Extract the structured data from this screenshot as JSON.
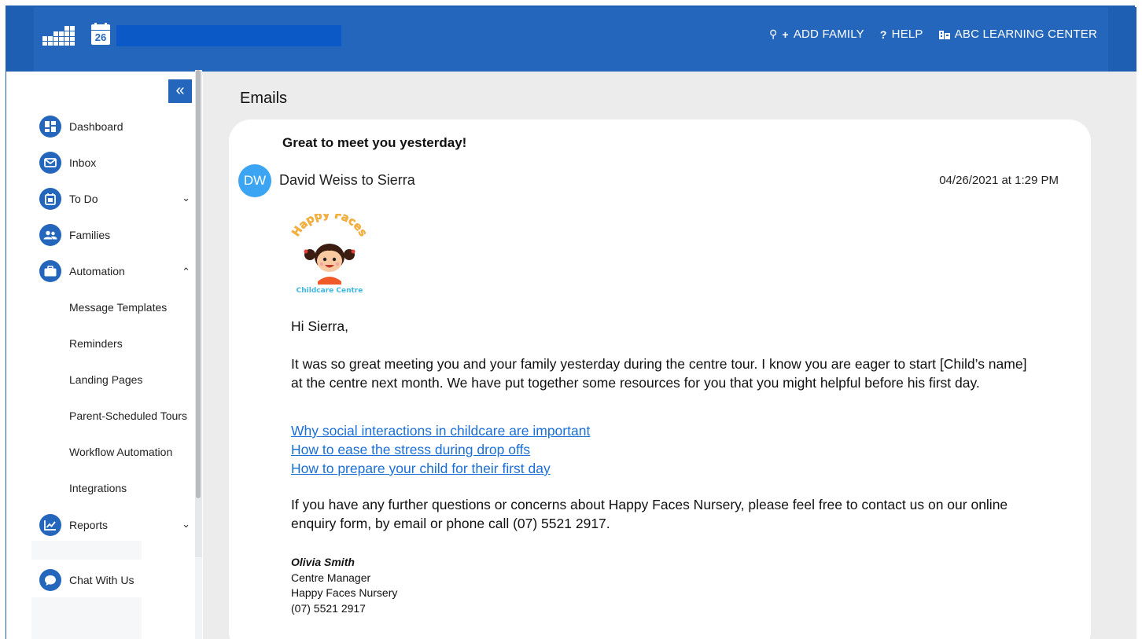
{
  "header": {
    "calendar_day": "26",
    "add_family_label": "ADD FAMILY",
    "help_label": "HELP",
    "center_label": "ABC LEARNING CENTER",
    "colors": {
      "header_bg": "#2466bb",
      "accent": "#2466bb"
    }
  },
  "sidebar": {
    "collapse_icon": "«",
    "items": [
      {
        "label": "Dashboard",
        "icon": "dashboard-icon"
      },
      {
        "label": "Inbox",
        "icon": "envelope-icon"
      },
      {
        "label": "To Do",
        "icon": "calendar-icon",
        "expanded": false
      },
      {
        "label": "Families",
        "icon": "people-icon"
      },
      {
        "label": "Automation",
        "icon": "briefcase-icon",
        "expanded": true
      },
      {
        "label": "Reports",
        "icon": "chart-icon",
        "expanded": false
      },
      {
        "label": "Chat With Us",
        "icon": "chat-icon"
      }
    ],
    "automation_children": [
      "Message Templates",
      "Reminders",
      "Landing Pages",
      "Parent-Scheduled Tours",
      "Workflow Automation",
      "Integrations"
    ]
  },
  "main": {
    "page_title": "Emails",
    "email": {
      "subject": "Great to meet you yesterday!",
      "avatar_initials": "DW",
      "from_to": "David Weiss to Sierra",
      "timestamp": "04/26/2021 at 1:29 PM",
      "brand": {
        "arc_text": "Happy Faces",
        "subtitle": "Childcare Centre"
      },
      "greeting": "Hi Sierra,",
      "paragraph1": "It was so great meeting you and your family yesterday during the centre tour. I know you are eager to start [Child’s name] at the centre next month. We have put together some resources for you that you might helpful before his first day.",
      "links": [
        "Why social interactions in childcare are important",
        "How to ease the stress during drop offs",
        "How to prepare your child for their first day"
      ],
      "paragraph2": "If you have any further questions or concerns about Happy Faces Nursery, please feel free to contact us on our online enquiry form, by email or phone call (07) 5521 2917.",
      "signature": {
        "name": "Olivia Smith",
        "title": "Centre Manager",
        "org": "Happy Faces Nursery",
        "phone": "(07) 5521 2917"
      }
    }
  }
}
